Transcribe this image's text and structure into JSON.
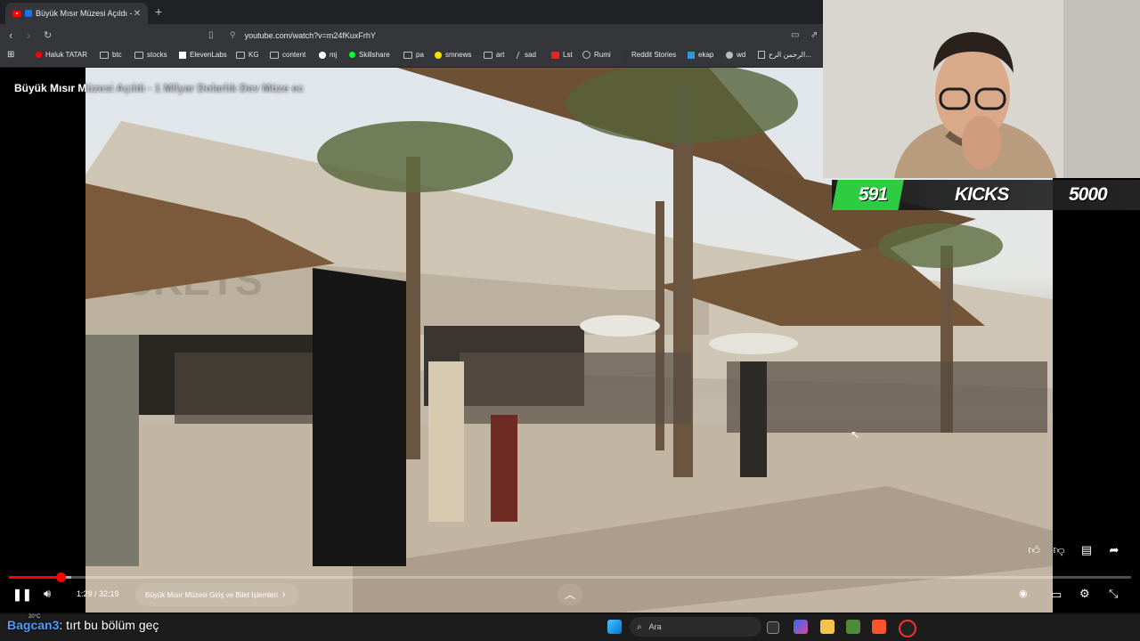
{
  "browser": {
    "tab_title": "Büyük Mısır Müzesi Açıldı - 1",
    "tab_close": "✕",
    "new_tab": "+",
    "url": "youtube.com/watch?v=m24fKuxFrhY",
    "bookmarks": [
      "Haluk TATAR",
      "btc",
      "stocks",
      "ElevenLabs",
      "KG",
      "content",
      "mj",
      "Skillshare",
      "pa",
      "smnews",
      "art",
      "sad",
      "Lst",
      "Rumi",
      "Reddit Stories",
      "ekap",
      "wd",
      "الرحمن الرح..."
    ]
  },
  "video": {
    "title_visible": "Büyük Mısır M",
    "title_faded": "üzesi Açıldı - 1 Milyar Dolarlık Dev Müze ec"
  },
  "player": {
    "time": "1:29 / 32:19",
    "chapter": "Büyük Mısır Müzesi Giriş ve Bilet İşlemleri",
    "chapter_arrow": "›",
    "progress_fraction": 0.046
  },
  "stream_goal": {
    "current": "591",
    "label": "KICKS",
    "target": "5000"
  },
  "chat": {
    "user": "Bagcan3",
    "message": ": tırt bu bölüm geç",
    "temp": "20°C"
  },
  "taskbar": {
    "search_placeholder": "Ara"
  },
  "colors": {
    "accent_red": "#ff0000",
    "goal_green": "#2ecc40",
    "chrome_dark": "#35363a"
  }
}
